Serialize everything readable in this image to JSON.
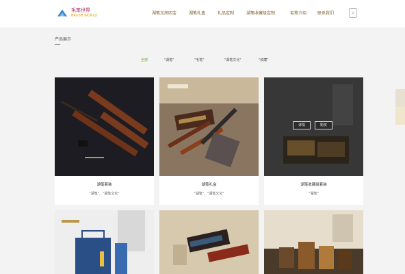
{
  "header": {
    "logo_text": "毛笔世界",
    "logo_sub": "BRUSH WORLD",
    "nav": [
      "湖笔文房四宝",
      "湖笔礼盒",
      "礼品定制",
      "湖笔收藏级定制",
      "毛笔介绍",
      "联系我们"
    ],
    "cart_label": "0"
  },
  "section": {
    "title": "产品展示"
  },
  "filters": {
    "items": [
      "全部",
      "\"湖笔\"",
      "\"毛笔\"",
      "\"湖笔文化\"",
      "\"收藏\""
    ],
    "active_index": 0
  },
  "cards": [
    {
      "title": "湖笔套装",
      "tags": "\"湖笔\"、\"湖笔文化\"",
      "image": "brush-set-dark"
    },
    {
      "title": "湖笔礼盒",
      "tags": "\"湖笔\"、\"湖笔文化\"",
      "image": "brush-gift-box"
    },
    {
      "title": "湖笔收藏级套装",
      "tags": "\"湖笔\"",
      "image": "collection-box-dark",
      "overlay_buttons": [
        "详情",
        "购买"
      ]
    },
    {
      "title": "",
      "tags": "",
      "image": "blue-gift-bag"
    },
    {
      "title": "",
      "tags": "",
      "image": "brush-case-calligraphy"
    },
    {
      "title": "",
      "tags": "",
      "image": "ink-jars"
    }
  ],
  "colors": {
    "accent_green": "#6ea82a",
    "nav_brown": "#7a5a2a",
    "logo_purple": "#a52a6b"
  }
}
